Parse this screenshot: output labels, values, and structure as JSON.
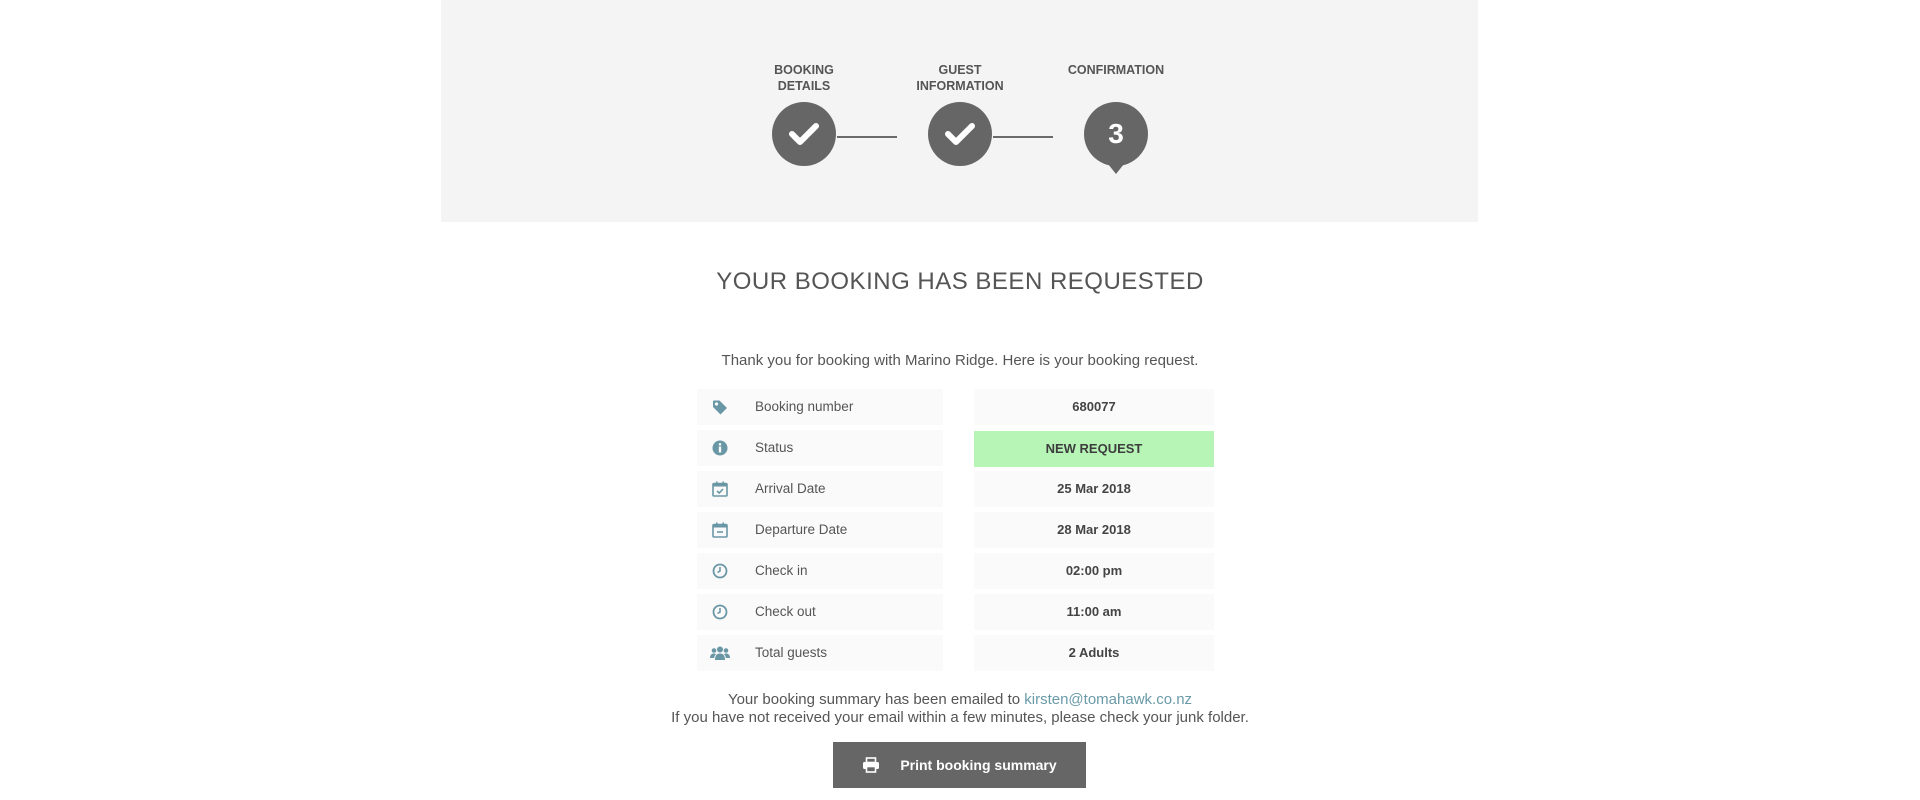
{
  "steps": [
    {
      "label_line1": "Booking",
      "label_line2": "Details",
      "state": "done",
      "icon": "check-icon"
    },
    {
      "label_line1": "Guest",
      "label_line2": "Information",
      "state": "done",
      "icon": "check-icon"
    },
    {
      "label_line1": "Confirmation",
      "label_line2": "",
      "state": "current",
      "number": "3"
    }
  ],
  "page": {
    "title": "YOUR BOOKING HAS BEEN REQUESTED",
    "intro": "Thank you for booking with Marino Ridge. Here is your booking request."
  },
  "booking": {
    "rows": [
      {
        "icon": "tag-icon",
        "label": "Booking number",
        "value": "680077"
      },
      {
        "icon": "info-icon",
        "label": "Status",
        "value": "NEW REQUEST"
      },
      {
        "icon": "calendar-check-icon",
        "label": "Arrival Date",
        "value": "25 Mar 2018"
      },
      {
        "icon": "calendar-minus-icon",
        "label": "Departure Date",
        "value": "28 Mar 2018"
      },
      {
        "icon": "clock-icon",
        "label": "Check in",
        "value": "02:00 pm"
      },
      {
        "icon": "clock-icon",
        "label": "Check out",
        "value": "11:00 am"
      },
      {
        "icon": "users-icon",
        "label": "Total guests",
        "value": "2 Adults"
      }
    ]
  },
  "footer": {
    "email_prefix": "Your booking summary has been emailed to",
    "email": "kirsten@tomahawk.co.nz",
    "junk_note": "If you have not received your email within a few minutes, please check your junk folder.",
    "print_label": "Print booking summary",
    "print_icon": "printer-icon"
  },
  "colors": {
    "panel_bg": "#f4f4f4",
    "step_circle": "#666666",
    "status_bg": "#b7f5b7",
    "icon_color": "#6a97a5",
    "link_color": "#6a9aa8",
    "button_bg": "#666666"
  }
}
